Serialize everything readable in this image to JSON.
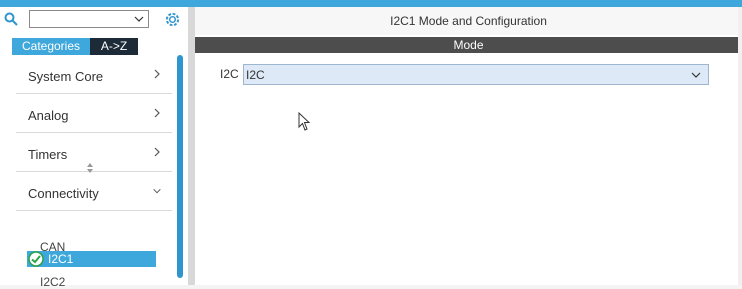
{
  "left": {
    "search": {
      "value": ""
    },
    "tabs": [
      {
        "label": "Categories",
        "active": true
      },
      {
        "label": "A->Z",
        "active": false
      }
    ],
    "categories": [
      {
        "label": "System Core",
        "expanded": false
      },
      {
        "label": "Analog",
        "expanded": false
      },
      {
        "label": "Timers",
        "expanded": false
      },
      {
        "label": "Connectivity",
        "expanded": true
      }
    ],
    "connectivity_items": [
      {
        "label": "CAN",
        "selected": false
      },
      {
        "label": "I2C1",
        "selected": true,
        "status": "check"
      },
      {
        "label": "I2C2",
        "selected": false
      }
    ]
  },
  "panel": {
    "title": "I2C1 Mode and Configuration",
    "section": "Mode",
    "field_label": "I2C",
    "field_value": "I2C"
  },
  "colors": {
    "accent": "#3ea7db",
    "dark": "#1d2b38",
    "check": "#2aa34a"
  }
}
